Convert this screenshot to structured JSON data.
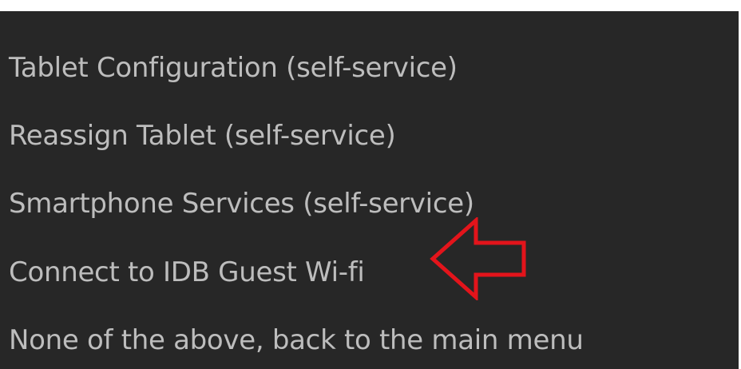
{
  "menu": {
    "items": [
      {
        "label": "Tablet Configuration (self-service)"
      },
      {
        "label": "Reassign Tablet (self-service)"
      },
      {
        "label": "Smartphone Services (self-service)"
      },
      {
        "label": "Connect to IDB Guest Wi-fi"
      },
      {
        "label": "None of the above, back to the main menu"
      }
    ]
  },
  "annotation": {
    "icon": "left-arrow-outline-icon",
    "color": "#e3141b"
  },
  "colors": {
    "background": "#272727",
    "text": "#bdbdbd"
  }
}
